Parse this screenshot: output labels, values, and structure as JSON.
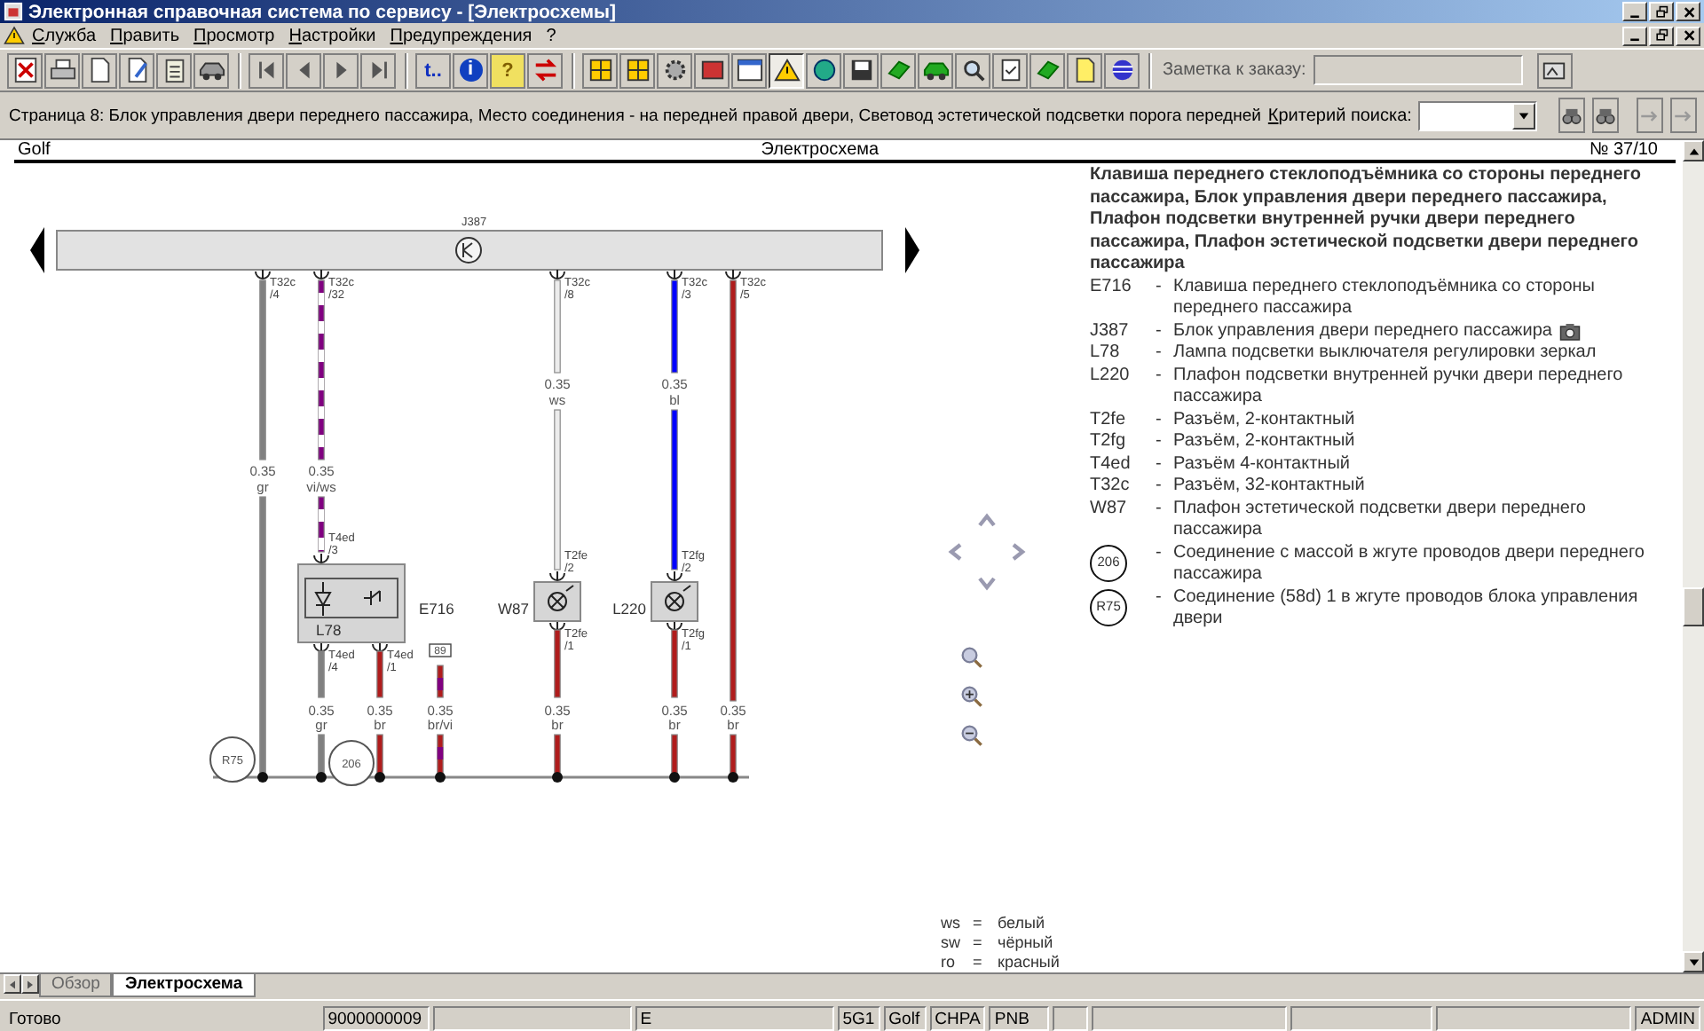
{
  "window": {
    "title": "Электронная справочная система по сервису - [Электросхемы]"
  },
  "menu": [
    "Служба",
    "Править",
    "Просмотр",
    "Настройки",
    "Предупреждения",
    "?"
  ],
  "toolbar": {
    "glyph_buttons": [
      "t..",
      "i",
      "?"
    ],
    "note_label": "Заметка к заказу:"
  },
  "info_bar": {
    "page_text": "Страница 8: Блок управления двери переднего пассажира, Место соединения - на передней правой двери, Световод эстетической подсветки порога передней",
    "search_label": "Критерий поиска:"
  },
  "document": {
    "header": {
      "left": "Golf",
      "center": "Электросхема",
      "right": "№ 37/10"
    },
    "diagram": {
      "control_unit": {
        "label": "J387"
      },
      "upper_wires": [
        {
          "connector": "T32c",
          "pin": "/4",
          "gauge": "0.35",
          "code": "gr",
          "color": "#808080"
        },
        {
          "connector": "T32c",
          "pin": "/32",
          "gauge": "0.35",
          "code": "vi/ws",
          "color": "#800080",
          "stripe": {
            "color": "#ffffff"
          },
          "end_connector": "T4ed",
          "end_pin": "/3"
        },
        {
          "connector": "T32c",
          "pin": "/8",
          "gauge": "0.35",
          "code": "ws",
          "color": "#ececec",
          "end_connector": "T2fe",
          "end_pin": "/2"
        },
        {
          "connector": "T32c",
          "pin": "/3",
          "gauge": "0.35",
          "code": "bl",
          "color": "#0000ff",
          "end_connector": "T2fg",
          "end_pin": "/2"
        },
        {
          "connector": "T32c",
          "pin": "/5",
          "color": "#b01c1c"
        }
      ],
      "lower_wires": [
        {
          "connector": "T4ed",
          "pin": "/4",
          "gauge": "0.35",
          "code": "gr",
          "color": "#808080"
        },
        {
          "connector": "T4ed",
          "pin": "/1",
          "gauge": "0.35",
          "code": "br",
          "color": "#b01c1c"
        },
        {
          "terminal": "89",
          "gauge": "0.35",
          "code": "br/vi",
          "color": "#b01c1c",
          "stripe": {
            "color": "#800080"
          }
        },
        {
          "connector": "T2fe",
          "pin": "/1",
          "gauge": "0.35",
          "code": "br",
          "color": "#b01c1c"
        },
        {
          "connector": "T2fg",
          "pin": "/1",
          "gauge": "0.35",
          "code": "br",
          "color": "#b01c1c"
        },
        {
          "gauge": "0.35",
          "code": "br",
          "color": "#b01c1c"
        }
      ],
      "components": [
        {
          "kind": "switch",
          "label": "E716",
          "sublabel": "L78"
        },
        {
          "kind": "lamp",
          "label": "W87"
        },
        {
          "kind": "lamp",
          "label": "L220"
        }
      ],
      "grounds": [
        {
          "label": "R75"
        },
        {
          "label": "206"
        }
      ]
    },
    "legend": {
      "title": "Клавиша переднего стеклоподъёмника со стороны переднего пассажира, Блок управления двери переднего пассажира, Плафон подсветки внутренней ручки двери переднего пассажира, Плафон эстетической подсветки двери переднего пассажира",
      "entries": [
        {
          "kind": "code",
          "code": "E716",
          "dash": "-",
          "text": "Клавиша переднего стеклоподъёмника со стороны переднего пассажира",
          "camera": false
        },
        {
          "kind": "code",
          "code": "J387",
          "dash": "-",
          "text": "Блок управления двери переднего пассажира",
          "camera": true
        },
        {
          "kind": "code",
          "code": "L78",
          "dash": "-",
          "text": "Лампа подсветки выключателя регулировки зеркал",
          "camera": false
        },
        {
          "kind": "code",
          "code": "L220",
          "dash": "-",
          "text": "Плафон подсветки внутренней ручки двери переднего пассажира",
          "camera": false
        },
        {
          "kind": "code",
          "code": "T2fe",
          "dash": "-",
          "text": "Разъём, 2-контактный",
          "camera": false
        },
        {
          "kind": "code",
          "code": "T2fg",
          "dash": "-",
          "text": "Разъём, 2-контактный",
          "camera": false
        },
        {
          "kind": "code",
          "code": "T4ed",
          "dash": "-",
          "text": "Разъём 4-контактный",
          "camera": false
        },
        {
          "kind": "code",
          "code": "T32c",
          "dash": "-",
          "text": "Разъём, 32-контактный",
          "camera": false
        },
        {
          "kind": "code",
          "code": "W87",
          "dash": "-",
          "text": "Плафон эстетической подсветки двери переднего пассажира",
          "camera": false
        },
        {
          "kind": "ground",
          "code": "206",
          "dash": "-",
          "text": "Соединение с массой в жгуте проводов двери переднего пассажира",
          "camera": false
        },
        {
          "kind": "ground",
          "code": "R75",
          "dash": "-",
          "text": "Соединение (58d) 1 в жгуте проводов блока управления двери",
          "camera": false
        }
      ]
    },
    "color_key": [
      {
        "code": "ws",
        "sep": "=",
        "name": "белый"
      },
      {
        "code": "sw",
        "sep": "=",
        "name": "чёрный"
      },
      {
        "code": "ro",
        "sep": "=",
        "name": "красный"
      }
    ]
  },
  "tabs": [
    {
      "label": "Обзор",
      "selected": false
    },
    {
      "label": "Электросхема",
      "selected": true
    }
  ],
  "status_bar": [
    "Готово",
    "9000000009",
    "E",
    "5G1",
    "Golf",
    "CHPA",
    "PNB",
    "ADMIN"
  ]
}
